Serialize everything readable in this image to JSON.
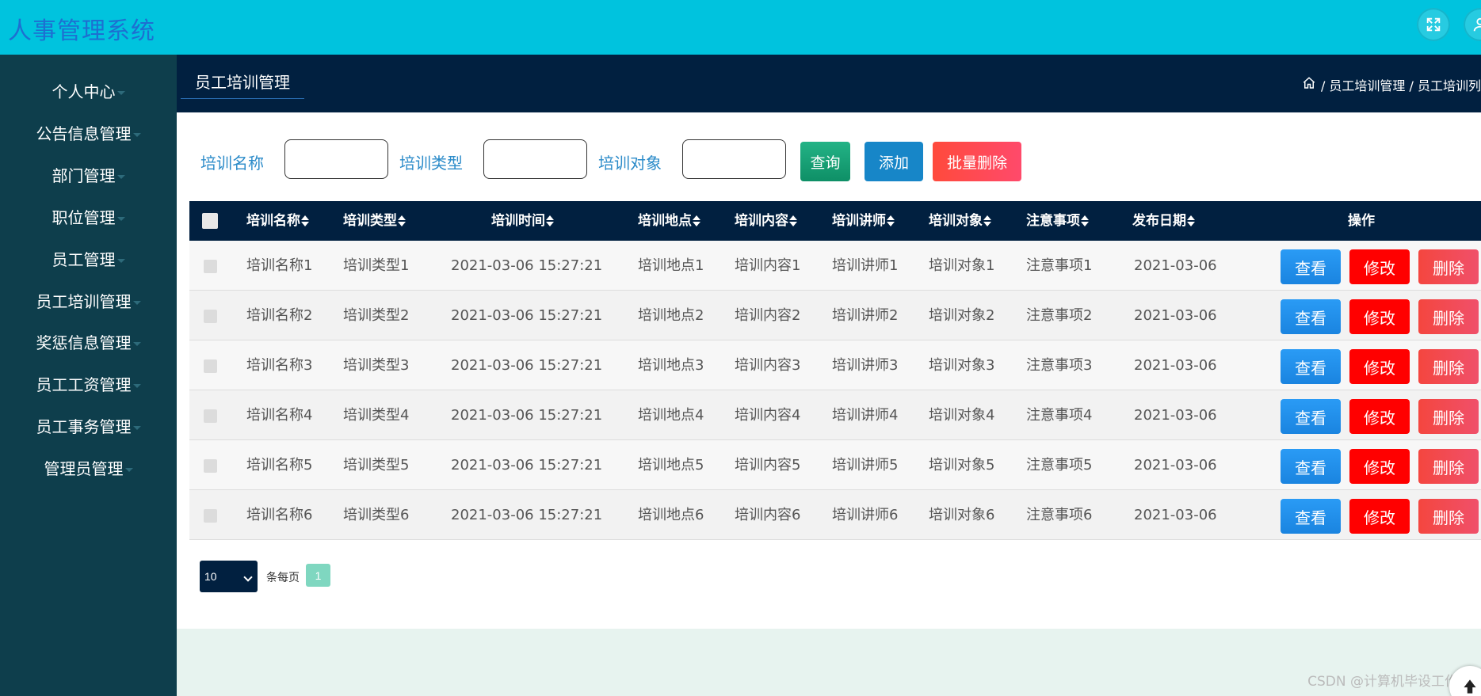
{
  "header": {
    "title": "人事管理系统",
    "colors": {
      "bar": "#00c3de",
      "title": "#1d6fd1"
    },
    "icons": [
      "fullscreen-icon",
      "user-icon"
    ]
  },
  "sidebar": {
    "items": [
      {
        "label": "个人中心"
      },
      {
        "label": "公告信息管理"
      },
      {
        "label": "部门管理"
      },
      {
        "label": "职位管理"
      },
      {
        "label": "员工管理"
      },
      {
        "label": "员工培训管理"
      },
      {
        "label": "奖惩信息管理"
      },
      {
        "label": "员工工资管理"
      },
      {
        "label": "员工事务管理"
      },
      {
        "label": "管理员管理"
      }
    ]
  },
  "subheader": {
    "title": "员工培训管理",
    "breadcrumb": "/ 员工培训管理 / 员工培训列"
  },
  "search": {
    "field1_label": "培训名称",
    "field2_label": "培训类型",
    "field3_label": "培训对象",
    "query_label": "查询",
    "add_label": "添加",
    "batch_delete_label": "批量删除"
  },
  "table": {
    "headers": {
      "name": "培训名称",
      "type": "培训类型",
      "time": "培训时间",
      "place": "培训地点",
      "content": "培训内容",
      "lecturer": "培训讲师",
      "target": "培训对象",
      "notes": "注意事项",
      "date": "发布日期",
      "ops": "操作"
    },
    "rows": [
      {
        "name": "培训名称1",
        "type": "培训类型1",
        "time": "2021-03-06 15:27:21",
        "place": "培训地点1",
        "content": "培训内容1",
        "lecturer": "培训讲师1",
        "target": "培训对象1",
        "notes": "注意事项1",
        "date": "2021-03-06"
      },
      {
        "name": "培训名称2",
        "type": "培训类型2",
        "time": "2021-03-06 15:27:21",
        "place": "培训地点2",
        "content": "培训内容2",
        "lecturer": "培训讲师2",
        "target": "培训对象2",
        "notes": "注意事项2",
        "date": "2021-03-06"
      },
      {
        "name": "培训名称3",
        "type": "培训类型3",
        "time": "2021-03-06 15:27:21",
        "place": "培训地点3",
        "content": "培训内容3",
        "lecturer": "培训讲师3",
        "target": "培训对象3",
        "notes": "注意事项3",
        "date": "2021-03-06"
      },
      {
        "name": "培训名称4",
        "type": "培训类型4",
        "time": "2021-03-06 15:27:21",
        "place": "培训地点4",
        "content": "培训内容4",
        "lecturer": "培训讲师4",
        "target": "培训对象4",
        "notes": "注意事项4",
        "date": "2021-03-06"
      },
      {
        "name": "培训名称5",
        "type": "培训类型5",
        "time": "2021-03-06 15:27:21",
        "place": "培训地点5",
        "content": "培训内容5",
        "lecturer": "培训讲师5",
        "target": "培训对象5",
        "notes": "注意事项5",
        "date": "2021-03-06"
      },
      {
        "name": "培训名称6",
        "type": "培训类型6",
        "time": "2021-03-06 15:27:21",
        "place": "培训地点6",
        "content": "培训内容6",
        "lecturer": "培训讲师6",
        "target": "培训对象6",
        "notes": "注意事项6",
        "date": "2021-03-06"
      }
    ],
    "row_actions": {
      "view": "查看",
      "edit": "修改",
      "delete": "删除"
    }
  },
  "pagination": {
    "page_size": "10",
    "per_page_label": "条每页",
    "current_page": "1"
  },
  "watermark": "CSDN @计算机毕设工作室",
  "colors": {
    "sidebar": "#0e3e4c",
    "subheader": "#012040",
    "view_button": "#2196f3",
    "edit_button": "#ff0000",
    "delete_button": "#f0504f",
    "query_button": "#14a374",
    "add_button": "#1786c8",
    "batch_delete_button": "#ff4a55"
  }
}
